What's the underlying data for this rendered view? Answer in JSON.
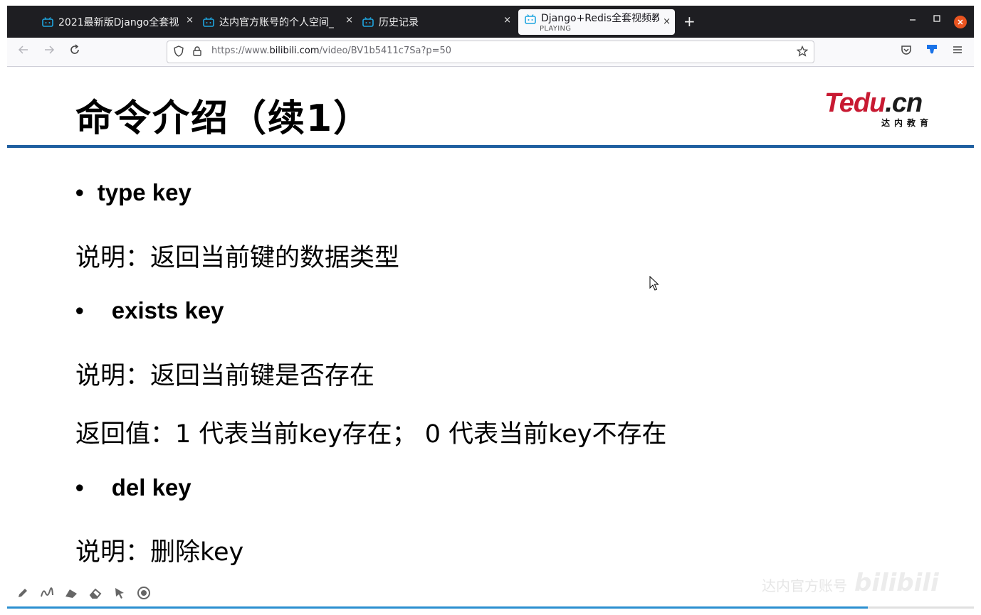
{
  "tabs": [
    {
      "title": "2021最新版Django全套视",
      "icon": "bilibili-icon"
    },
    {
      "title": "达内官方账号的个人空间_",
      "icon": "bilibili-icon"
    },
    {
      "title": "历史记录",
      "icon": "bilibili-icon"
    },
    {
      "title": "Django+Redis全套视频教",
      "subtitle": "PLAYING",
      "icon": "bilibili-icon",
      "active": true
    }
  ],
  "tab_close_glyph": "×",
  "new_tab_glyph": "+",
  "url": {
    "prefix": "https://www.",
    "domain": "bilibili.com",
    "path": "/video/BV1b5411c7Sa?p=50"
  },
  "slide": {
    "title": "命令介绍（续1）",
    "logo_main_red": "Tedu",
    "logo_main_dark": ".cn",
    "logo_sub": "达内教育",
    "lines": [
      {
        "kind": "bullet",
        "text": "type key"
      },
      {
        "kind": "text",
        "text": "说明：返回当前键的数据类型"
      },
      {
        "kind": "bullet",
        "text": "exists key"
      },
      {
        "kind": "text",
        "text": "说明：返回当前键是否存在"
      },
      {
        "kind": "text",
        "text": "返回值：1 代表当前key存在；  0 代表当前key不存在"
      },
      {
        "kind": "bullet",
        "text": "del key"
      },
      {
        "kind": "text",
        "text": "说明：删除key"
      }
    ],
    "bullet_glyph": "•"
  },
  "watermark": {
    "text": "达内官方账号",
    "logo": "bilibili"
  },
  "progress_fraction": 0.89,
  "colors": {
    "accent_rule": "#1f5fa0",
    "logo_red": "#c81a32",
    "close_button": "#e95420",
    "progress": "#2a8fd0"
  }
}
